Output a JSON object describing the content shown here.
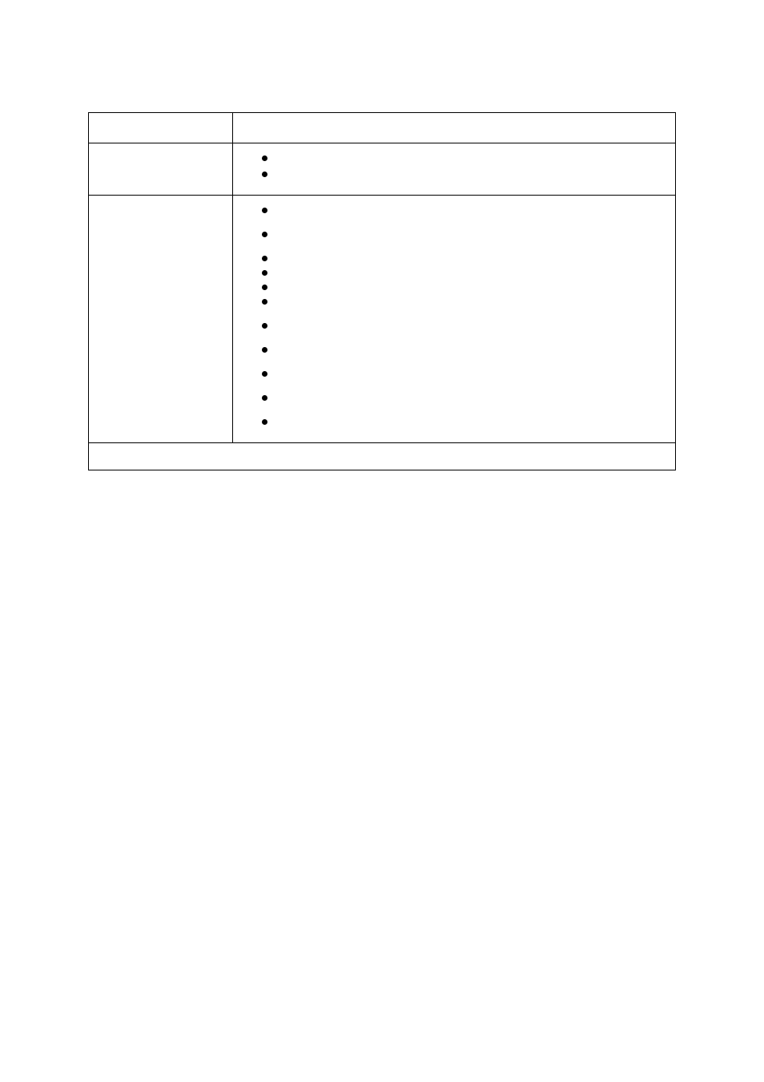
{
  "table": {
    "header": {
      "left": "",
      "right": ""
    },
    "rows": [
      {
        "label": "",
        "items": [
          {
            "text": ""
          },
          {
            "text": ""
          }
        ]
      },
      {
        "label": "",
        "items": [
          {
            "text": "",
            "gap": "small"
          },
          {
            "text": "",
            "gap": "small"
          },
          {
            "text": "",
            "gap": "tiny"
          },
          {
            "text": "",
            "gap": "tiny"
          },
          {
            "text": "",
            "gap": "tiny"
          },
          {
            "text": "",
            "gap": "small"
          },
          {
            "text": "",
            "gap": "small"
          },
          {
            "text": "",
            "gap": "small"
          },
          {
            "text": "",
            "gap": "small"
          },
          {
            "text": "",
            "gap": "small"
          },
          {
            "text": "",
            "gap": "small"
          }
        ]
      }
    ],
    "footer": ""
  }
}
